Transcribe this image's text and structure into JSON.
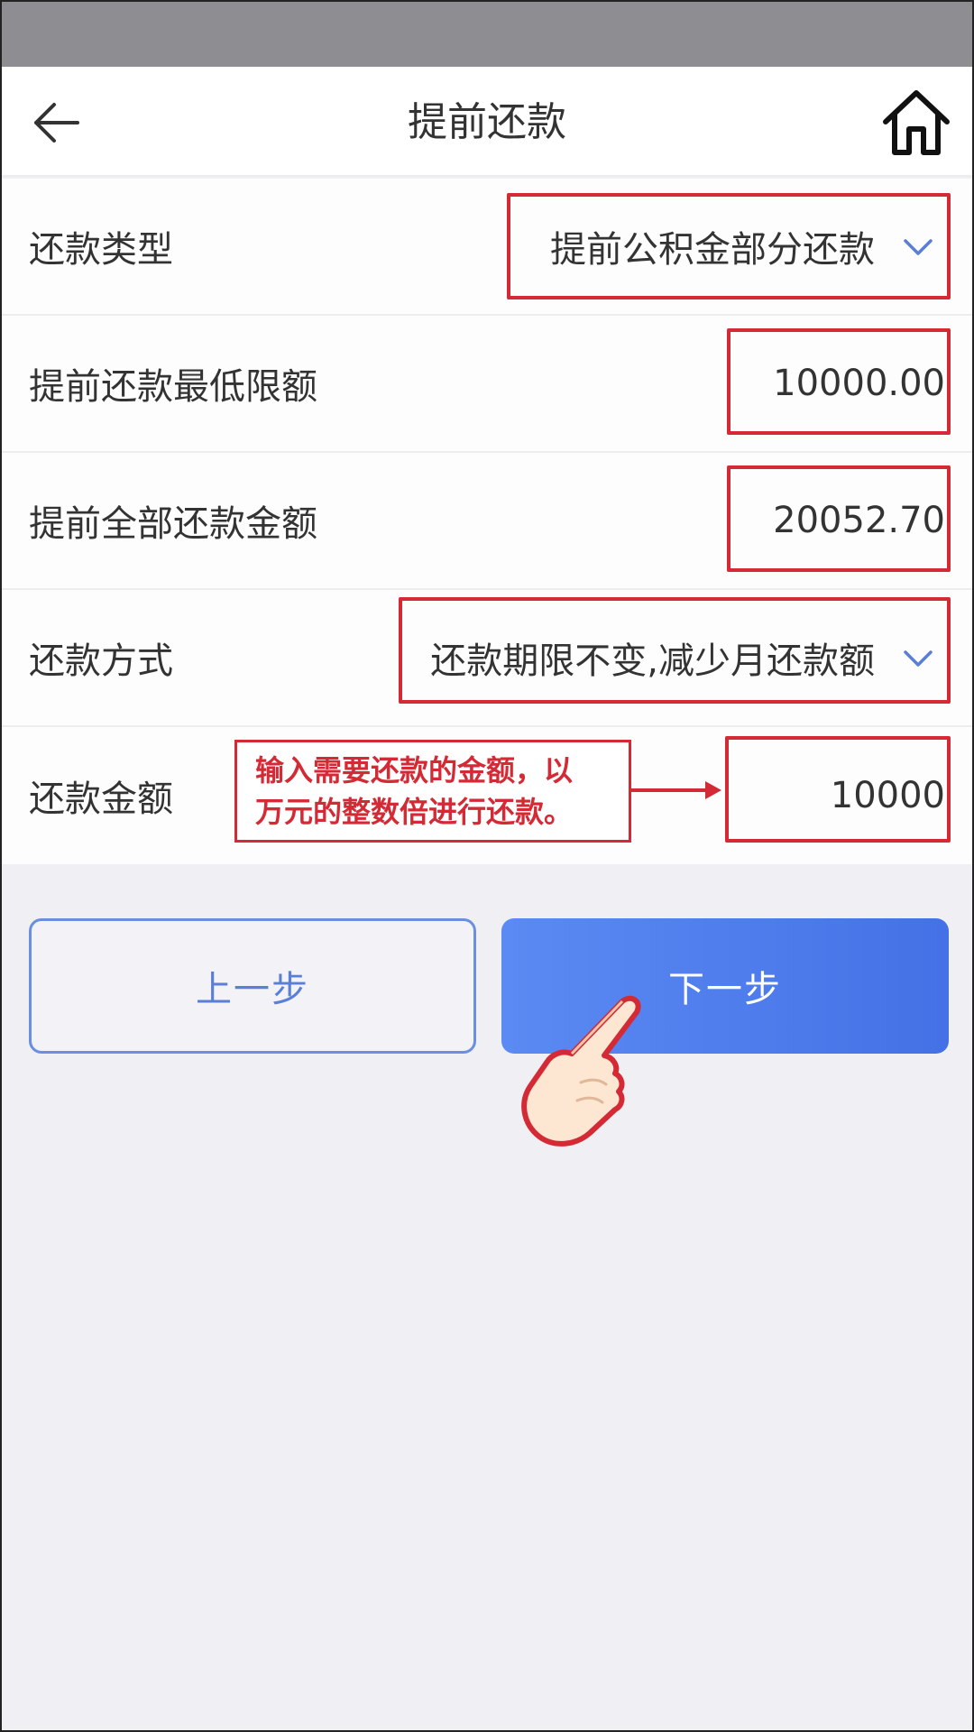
{
  "header": {
    "title": "提前还款"
  },
  "form": {
    "rows": [
      {
        "label": "还款类型",
        "value": "提前公积金部分还款",
        "type": "select"
      },
      {
        "label": "提前还款最低限额",
        "value": "10000.00",
        "type": "readonly"
      },
      {
        "label": "提前全部还款金额",
        "value": "20052.70",
        "type": "readonly"
      },
      {
        "label": "还款方式",
        "value": "还款期限不变,减少月还款额",
        "type": "select"
      },
      {
        "label": "还款金额",
        "value": "10000",
        "type": "input"
      }
    ]
  },
  "annotation": {
    "line1": "输入需要还款的金额，以",
    "line2": "万元的整数倍进行还款。",
    "color": "#d42a35"
  },
  "buttons": {
    "prev_label": "上一步",
    "next_label": "下一步"
  },
  "icons": {
    "back": "back-arrow-icon",
    "home": "home-icon",
    "dropdown": "chevron-down-icon",
    "pointer": "pointing-hand-icon"
  },
  "colors": {
    "accent": "#4d7bec",
    "highlight": "#d42a35",
    "status_bar": "#8e8d92"
  }
}
